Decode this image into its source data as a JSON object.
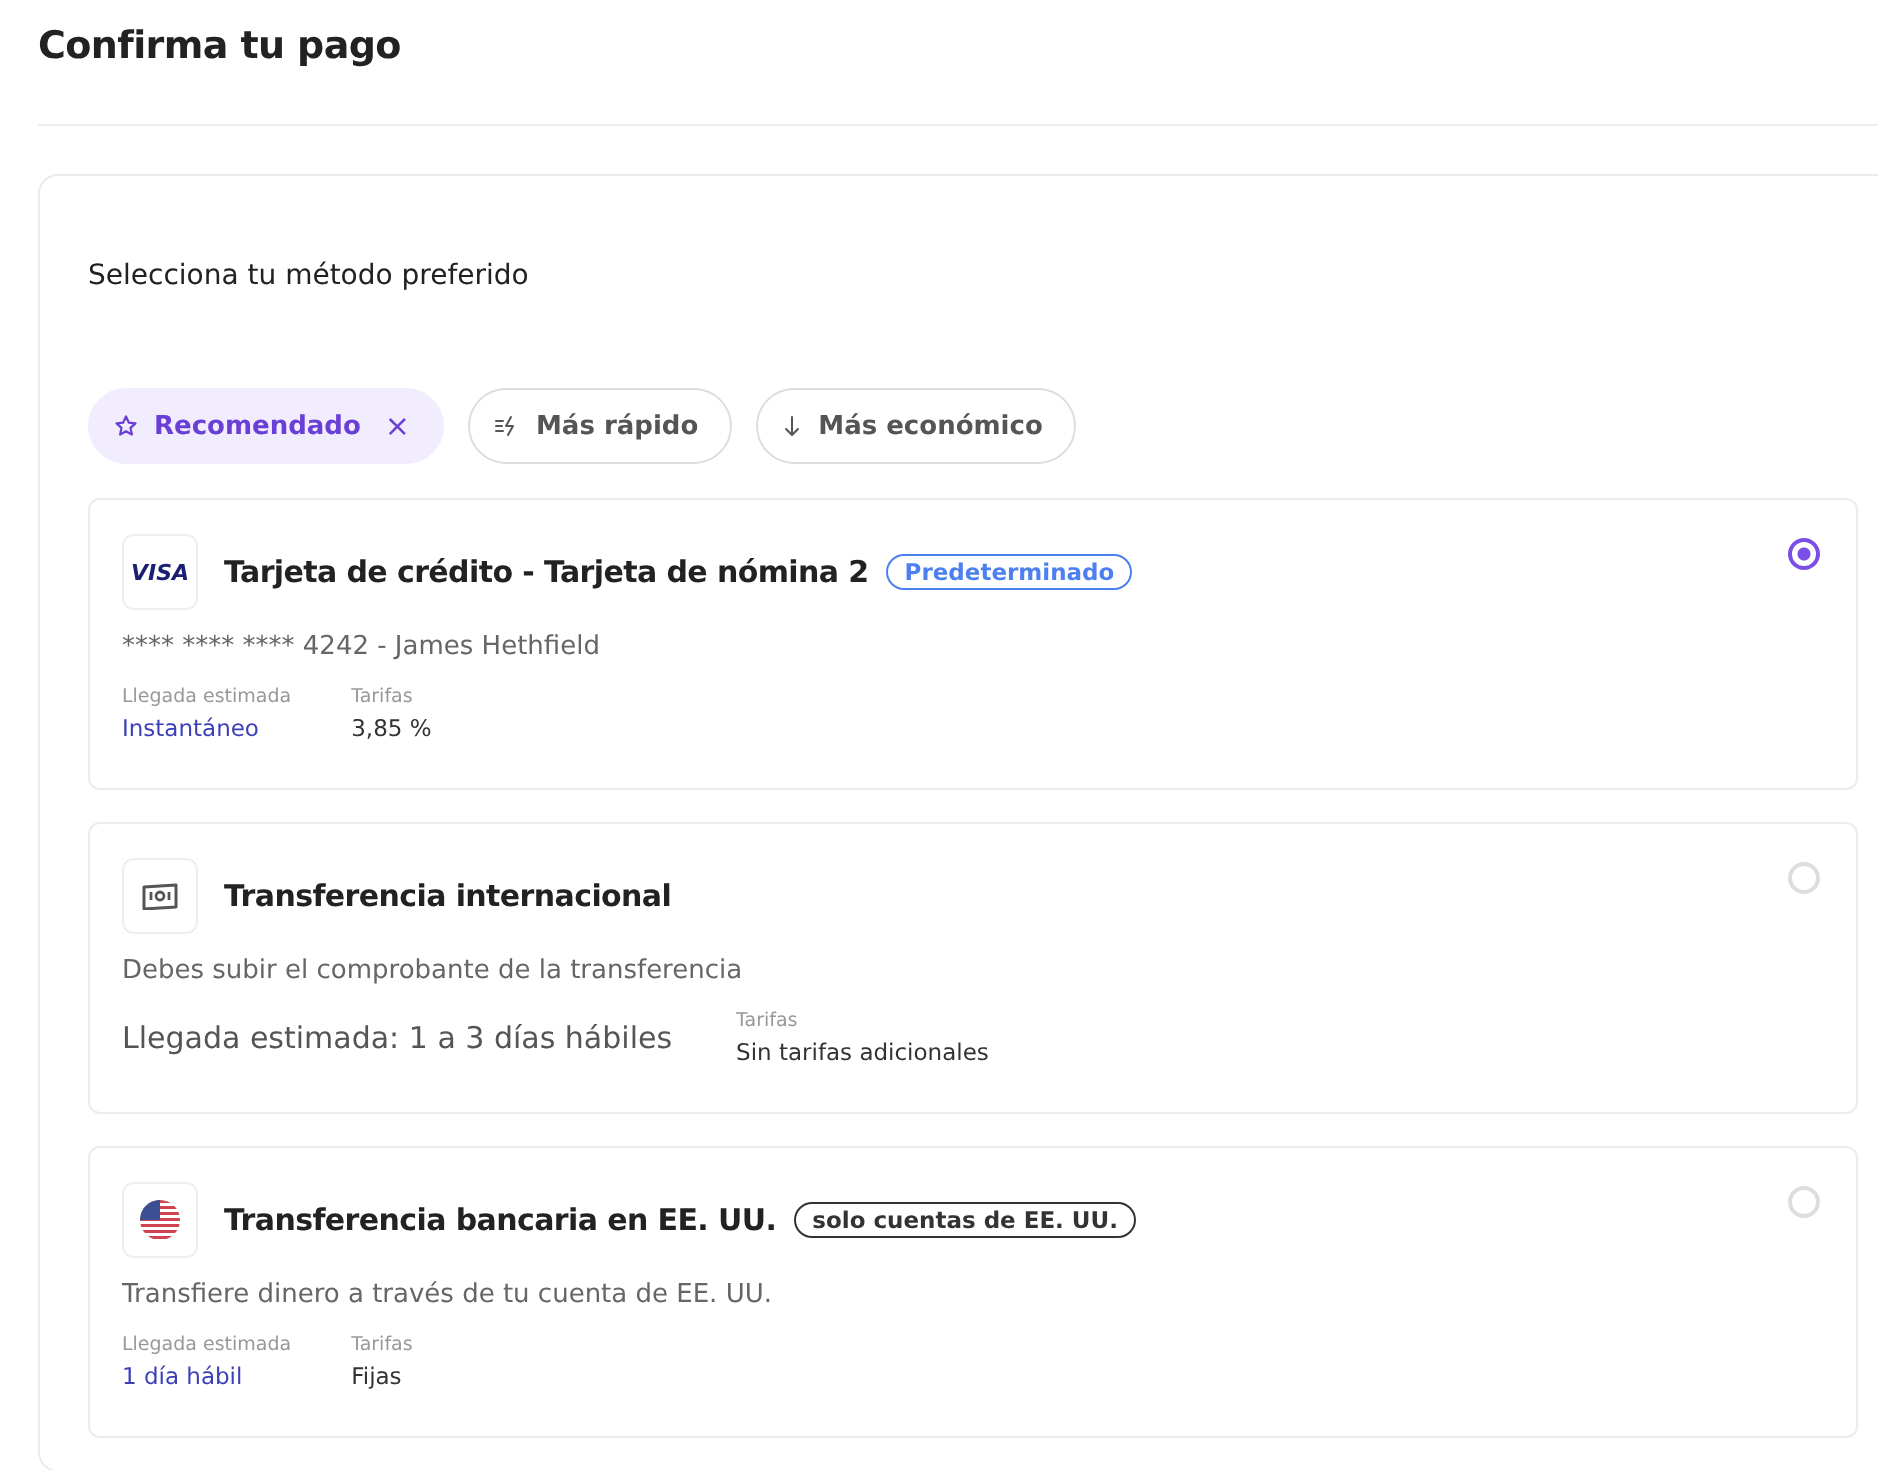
{
  "page_title": "Confirma tu pago",
  "section_title": "Selecciona tu método preferido",
  "filters": [
    {
      "kind": "recommended",
      "label": "Recomendado",
      "selected": true,
      "remove": "×"
    },
    {
      "kind": "fastest",
      "label": "Más rápido",
      "selected": false
    },
    {
      "kind": "cheapest",
      "label": "Más económico",
      "selected": false
    }
  ],
  "methods": [
    {
      "kind": "card",
      "logo_text": "VISA",
      "title": "Tarjeta de crédito - Tarjeta de nómina 2",
      "tag": {
        "kind": "default",
        "label": "Predeterminado"
      },
      "description": "**** **** **** 4242 - James Hethfield",
      "arrival_label": "Llegada estimada",
      "arrival": "Instantáneo",
      "fees_label": "Tarifas",
      "fees": "3,85 %",
      "selected": true
    },
    {
      "kind": "international",
      "title": "Transferencia internacional",
      "description": "Debes subir el comprobante de la transferencia",
      "arrival": "Llegada estimada: 1 a 3 días hábiles",
      "fees_label": "Tarifas",
      "fees": "Sin tarifas adicionales",
      "selected": false
    },
    {
      "kind": "us_bank",
      "title": "Transferencia bancaria en EE. UU.",
      "tag": {
        "kind": "restriction",
        "label": "solo cuentas de EE. UU."
      },
      "description": "Transfiere dinero a través de tu cuenta de EE. UU.",
      "arrival_label": "Llegada estimada",
      "arrival": "1 día hábil",
      "fees_label": "Tarifas",
      "fees": "Fijas",
      "selected": false
    }
  ]
}
